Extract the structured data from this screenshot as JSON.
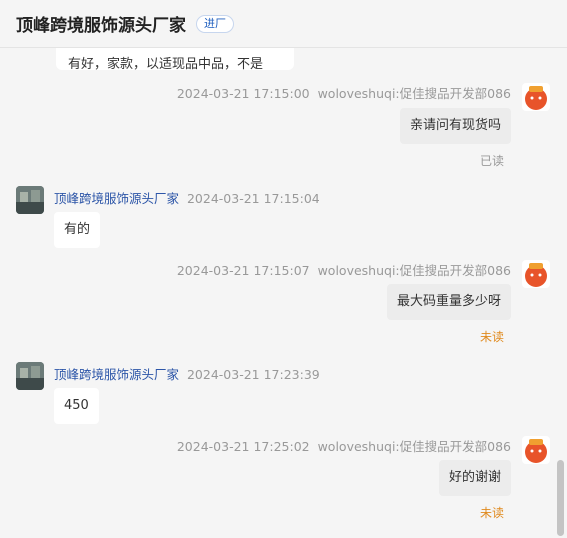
{
  "header": {
    "title": "顶峰跨境服饰源头厂家",
    "badge": "进厂"
  },
  "partial_message": {
    "text": "有好，家款，以适现品中品，不是"
  },
  "shop_name": "顶峰跨境服饰源头厂家",
  "me_name": "woloveshuqi:促佳搜品开发部086",
  "messages": [
    {
      "time": "2024-03-21 17:15:00",
      "text": "亲请问有现货吗",
      "status": "已读"
    },
    {
      "time": "2024-03-21 17:15:04",
      "text": "有的"
    },
    {
      "time": "2024-03-21 17:15:07",
      "text": "最大码重量多少呀",
      "status": "未读"
    },
    {
      "time": "2024-03-21 17:23:39",
      "text": "450"
    },
    {
      "time": "2024-03-21 17:25:02",
      "text": "好的谢谢",
      "status": "未读"
    }
  ],
  "colors": {
    "unread": "#e08a1e",
    "link": "#2d56a8",
    "accent_avatar": "#e8542a"
  }
}
